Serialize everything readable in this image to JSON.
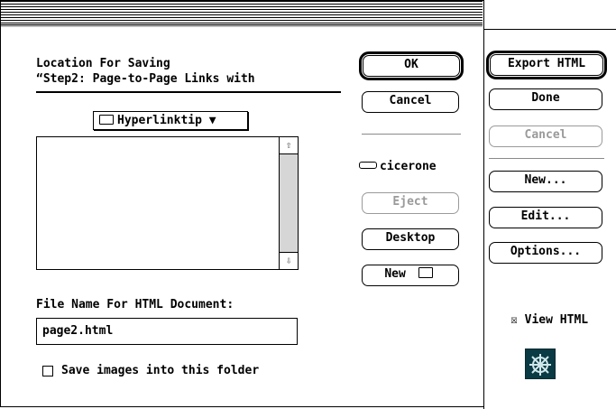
{
  "dialog": {
    "location_line1": "Location For Saving",
    "location_line2": "“Step2: Page-to-Page Links with",
    "folder_popup": "Hyperlinktip ▼",
    "ok_label": "OK",
    "cancel_label": "Cancel",
    "disk_name": "cicerone",
    "eject_label": "Eject",
    "desktop_label": "Desktop",
    "new_folder_label": "New",
    "file_name_label": "File Name For HTML Document:",
    "file_name_value": "page2.html",
    "save_images_label": "Save images into this folder",
    "save_images_checked": false
  },
  "palette": {
    "export_label": "Export HTML",
    "done_label": "Done",
    "cancel_label": "Cancel",
    "new_label": "New...",
    "edit_label": "Edit...",
    "options_label": "Options...",
    "view_html_label": "View HTML",
    "view_html_checked": true,
    "app_icon": "ship-wheel-icon"
  },
  "icons": {
    "scroll_up": "⇧",
    "scroll_down": "⇩",
    "checkbox_checked": "☒"
  }
}
